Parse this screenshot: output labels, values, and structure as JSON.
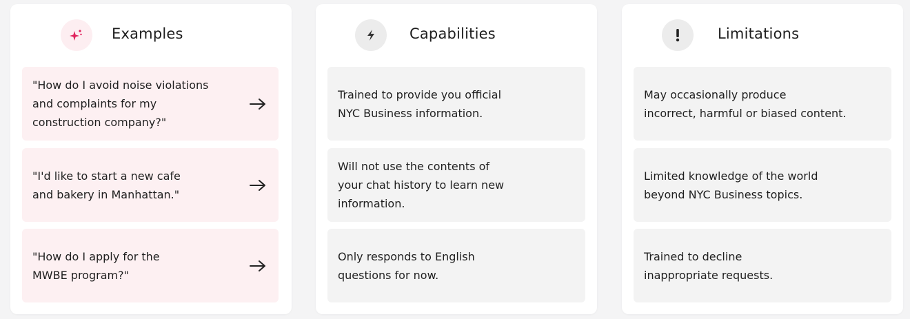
{
  "colors": {
    "page_background": "#f4f4f5",
    "card_background": "#ffffff",
    "examples_item_background": "#fdf0f2",
    "neutral_item_background": "#f3f3f3",
    "sparkle_accent": "#e0245e",
    "icon_circle_pink": "#fdeef1",
    "icon_circle_gray": "#ececec"
  },
  "columns": [
    {
      "title": "Examples",
      "icon": "sparkle-icon",
      "items": [
        {
          "text": "\"How do I avoid noise violations\nand complaints for my\nconstruction company?\"",
          "icon": "arrow-right-icon"
        },
        {
          "text": "\"I'd like to start a new cafe\nand bakery in Manhattan.\"",
          "icon": "arrow-right-icon"
        },
        {
          "text": "\"How do I apply for the\nMWBE program?\"",
          "icon": "arrow-right-icon"
        }
      ]
    },
    {
      "title": "Capabilities",
      "icon": "lightning-icon",
      "items": [
        {
          "text": "Trained to provide you official\nNYC Business information."
        },
        {
          "text": "Will not use the contents of\nyour chat history to learn new\ninformation."
        },
        {
          "text": "Only responds to English\nquestions for now."
        }
      ]
    },
    {
      "title": "Limitations",
      "icon": "exclamation-icon",
      "items": [
        {
          "text": "May occasionally produce\nincorrect, harmful or biased content."
        },
        {
          "text": "Limited knowledge of the world\nbeyond NYC Business topics."
        },
        {
          "text": "Trained to decline\ninappropriate requests."
        }
      ]
    }
  ]
}
